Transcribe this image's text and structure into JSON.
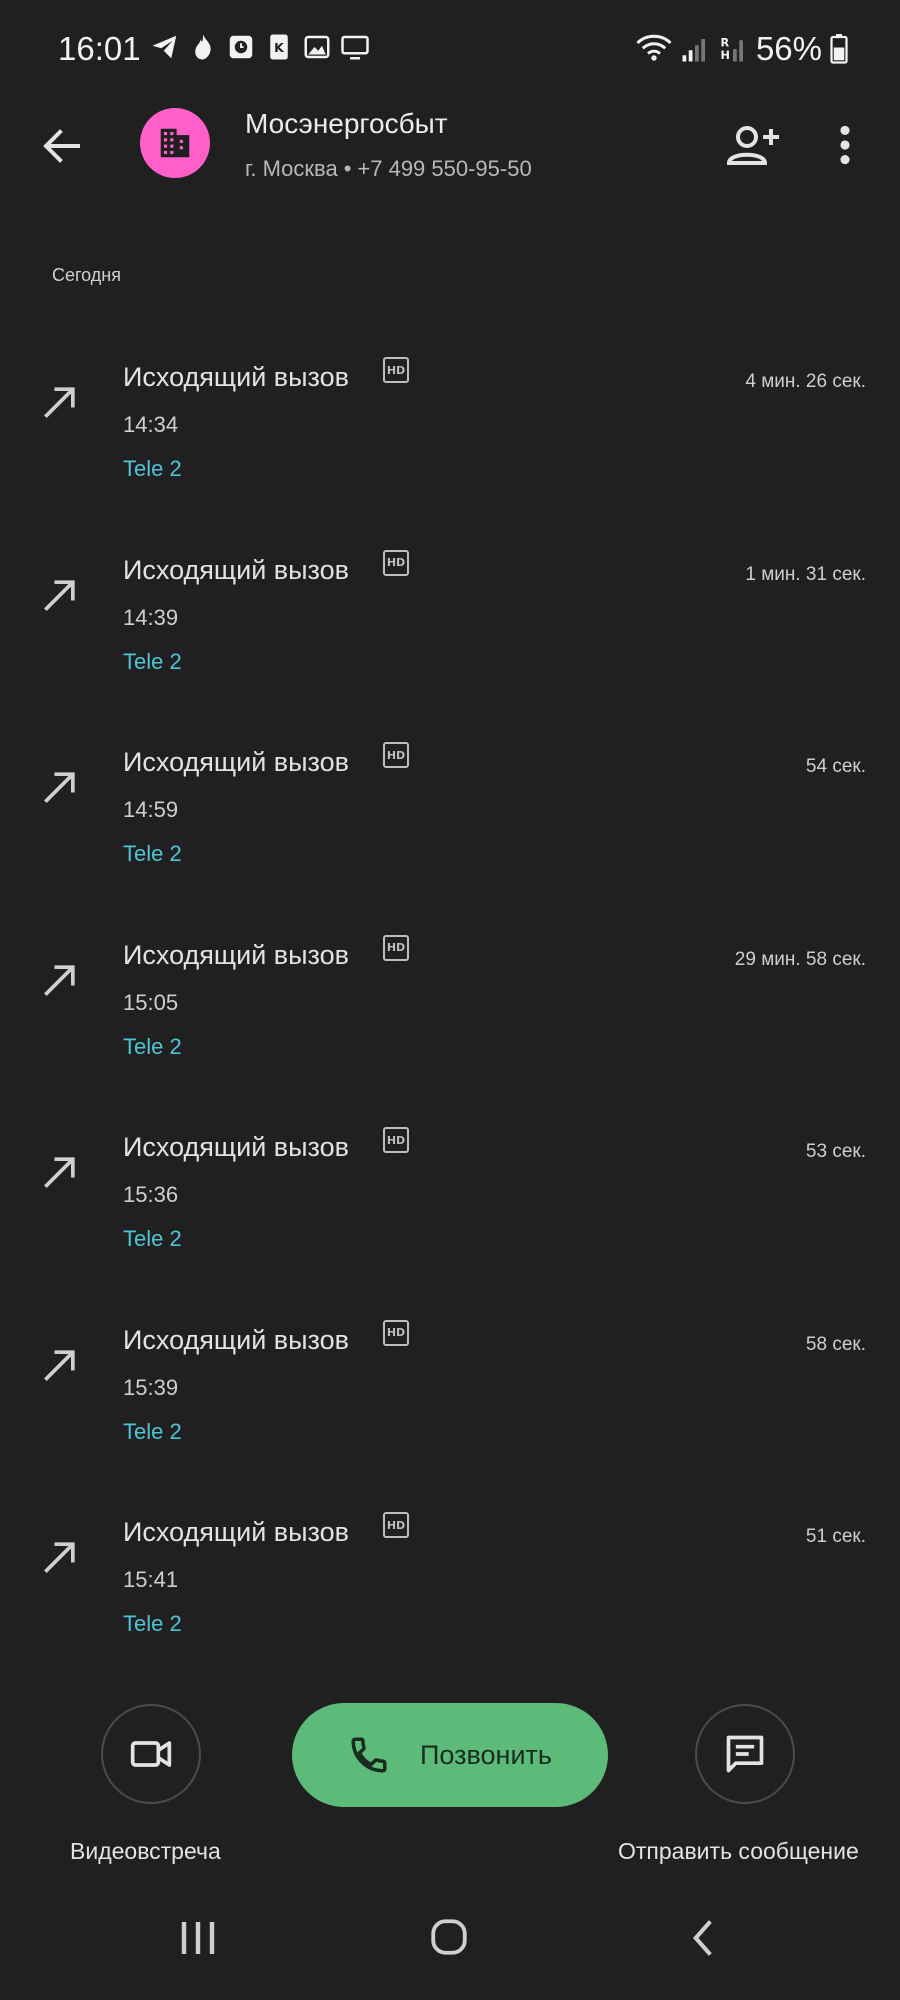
{
  "status_bar": {
    "time": "16:01",
    "battery_percent": "56%",
    "network_badge_top": "R",
    "network_badge_bottom": "H"
  },
  "header": {
    "contact_name": "Мосэнергосбыт",
    "location": "г. Москва",
    "separator": "•",
    "phone": "+7 499 550-95-50",
    "avatar_color": "#ff5fc8"
  },
  "section_label": "Сегодня",
  "calls": [
    {
      "type": "Исходящий вызов",
      "hd": "HD",
      "time": "14:34",
      "sim": "Tele 2",
      "duration": "4 мин. 26 сек."
    },
    {
      "type": "Исходящий вызов",
      "hd": "HD",
      "time": "14:39",
      "sim": "Tele 2",
      "duration": "1 мин. 31 сек."
    },
    {
      "type": "Исходящий вызов",
      "hd": "HD",
      "time": "14:59",
      "sim": "Tele 2",
      "duration": "54 сек."
    },
    {
      "type": "Исходящий вызов",
      "hd": "HD",
      "time": "15:05",
      "sim": "Tele 2",
      "duration": "29 мин. 58 сек."
    },
    {
      "type": "Исходящий вызов",
      "hd": "HD",
      "time": "15:36",
      "sim": "Tele 2",
      "duration": "53 сек."
    },
    {
      "type": "Исходящий вызов",
      "hd": "HD",
      "time": "15:39",
      "sim": "Tele 2",
      "duration": "58 сек."
    },
    {
      "type": "Исходящий вызов",
      "hd": "HD",
      "time": "15:41",
      "sim": "Tele 2",
      "duration": "51 сек."
    }
  ],
  "actions": {
    "video_label": "Видеовстреча",
    "call_label": "Позвонить",
    "message_label": "Отправить сообщение"
  },
  "colors": {
    "background": "#202020",
    "sim_accent": "#4fc3d7",
    "call_button": "#5dbb79"
  }
}
